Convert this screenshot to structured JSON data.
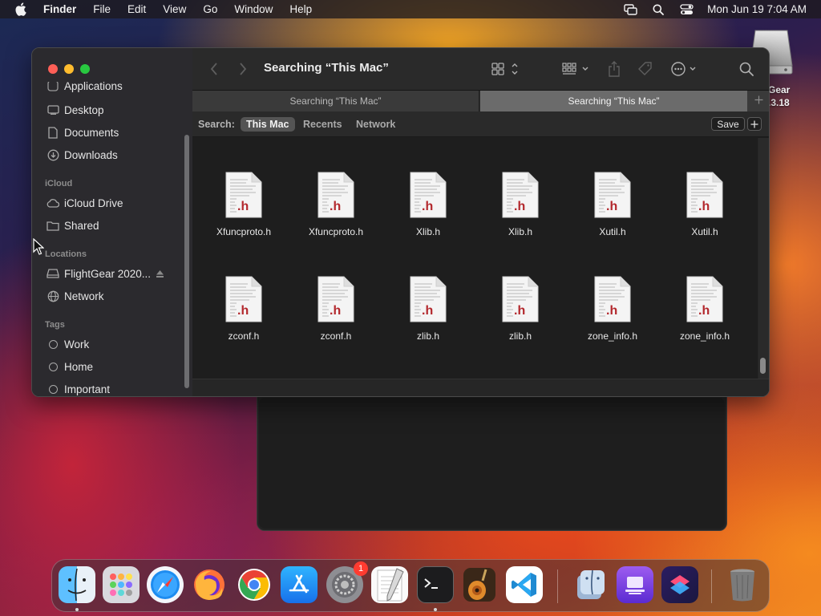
{
  "menubar": {
    "app_name": "Finder",
    "items": [
      "File",
      "Edit",
      "View",
      "Go",
      "Window",
      "Help"
    ],
    "clock": "Mon Jun 19  7:04 AM"
  },
  "desktop": {
    "disk_label_line1": "Gear",
    "disk_label_line2": ".3.18"
  },
  "finder": {
    "window_title": "Searching “This Mac”",
    "sidebar": {
      "partial_top": "Applications",
      "favorites": [
        "Desktop",
        "Documents",
        "Downloads"
      ],
      "icloud_header": "iCloud",
      "icloud": [
        "iCloud Drive",
        "Shared"
      ],
      "locations_header": "Locations",
      "locations": [
        "FlightGear 2020...",
        "Network"
      ],
      "tags_header": "Tags",
      "tags": [
        "Work",
        "Home",
        "Important"
      ]
    },
    "tabs": [
      {
        "label": "Searching “This Mac”",
        "active": false
      },
      {
        "label": "Searching “This Mac”",
        "active": true
      }
    ],
    "scope": {
      "label": "Search:",
      "options": [
        "This Mac",
        "Recents",
        "Network"
      ],
      "selected": "This Mac",
      "save_label": "Save"
    },
    "files": [
      {
        "name": "Xfuncproto.h",
        "ext": ".h"
      },
      {
        "name": "Xfuncproto.h",
        "ext": ".h"
      },
      {
        "name": "Xlib.h",
        "ext": ".h"
      },
      {
        "name": "Xlib.h",
        "ext": ".h"
      },
      {
        "name": "Xutil.h",
        "ext": ".h"
      },
      {
        "name": "Xutil.h",
        "ext": ".h"
      },
      {
        "name": "zconf.h",
        "ext": ".h"
      },
      {
        "name": "zconf.h",
        "ext": ".h"
      },
      {
        "name": "zlib.h",
        "ext": ".h"
      },
      {
        "name": "zlib.h",
        "ext": ".h"
      },
      {
        "name": "zone_info.h",
        "ext": ".h"
      },
      {
        "name": "zone_info.h",
        "ext": ".h"
      }
    ]
  },
  "dock": {
    "apps": [
      "finder",
      "launchpad",
      "safari",
      "firefox",
      "chrome",
      "app-store",
      "system-settings",
      "textedit",
      "terminal",
      "garageband",
      "vscode",
      "finder-alt",
      "podcasts-stack",
      "shortcuts",
      "trash"
    ],
    "settings_badge": "1"
  }
}
